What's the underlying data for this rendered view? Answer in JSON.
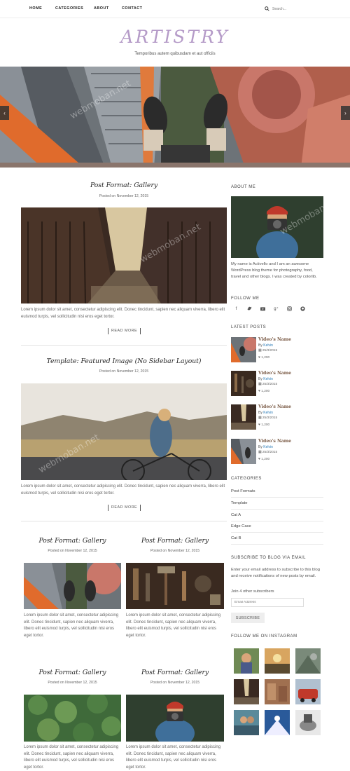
{
  "nav": {
    "items": [
      "HOME",
      "CATEGORIES",
      "ABOUT",
      "CONTACT"
    ],
    "search_placeholder": "Search..."
  },
  "site": {
    "logo": "ARTISTRY",
    "tagline": "Temporibus autem quibusdam et aut officiis"
  },
  "hero": {
    "prev": "‹",
    "next": "›"
  },
  "posts": [
    {
      "title": "Post Format: Gallery",
      "meta": "Posted on November 12, 2015",
      "excerpt": "Lorem ipsum dolor sit amet, consectetur adipiscing elit. Donec tincidunt, sapien nec aliquam viverra, libero elit euismod turpis, vel sollicitudin nisi eros eget tortor.",
      "read_more": "READ MORE"
    },
    {
      "title": "Template: Featured Image (No Sidebar Layout)",
      "meta": "Posted on November 12, 2015",
      "excerpt": "Lorem ipsum dolor sit amet, consectetur adipiscing elit. Donec tincidunt, sapien nec aliquam viverra, libero elit euismod turpis, vel sollicitudin nisi eros eget tortor.",
      "read_more": "READ MORE"
    }
  ],
  "grid_posts": [
    {
      "title": "Post Format: Gallery",
      "meta": "Posted on November 12, 2015",
      "excerpt": "Lorem ipsum dolor sit amet, consectetur adipiscing elit. Donec tincidunt, sapien nec aliquam viverra, libero elit euismod turpis, vel sollicitudin nisi eros eget tortor."
    },
    {
      "title": "Post Format: Gallery",
      "meta": "Posted on November 12, 2015",
      "excerpt": "Lorem ipsum dolor sit amet, consectetur adipiscing elit. Donec tincidunt, sapien nec aliquam viverra, libero elit euismod turpis, vel sollicitudin nisi eros eget tortor."
    },
    {
      "title": "Post Format: Gallery",
      "meta": "Posted on November 12, 2015",
      "excerpt": "Lorem ipsum dolor sit amet, consectetur adipiscing elit. Donec tincidunt, sapien nec aliquam viverra, libero elit euismod turpis, vel sollicitudin nisi eros eget tortor."
    },
    {
      "title": "Post Format: Gallery",
      "meta": "Posted on November 12, 2015",
      "excerpt": "Lorem ipsum dolor sit amet, consectetur adipiscing elit. Donec tincidunt, sapien nec aliquam viverra, libero elit euismod turpis, vel sollicitudin nisi eros eget tortor."
    }
  ],
  "sidebar": {
    "about_heading": "ABOUT ME",
    "about_text": "My name is Activello and I am an awesome WordPress blog theme for photography, food, travel and other blogs. I was created by colorlib.",
    "follow_heading": "FOLLOW ME",
    "social_icons": [
      "facebook-icon",
      "twitter-icon",
      "youtube-icon",
      "google-plus-icon",
      "instagram-icon",
      "github-icon"
    ],
    "latest_heading": "LATEST POSTS",
    "latest_posts": [
      {
        "title": "Video's Name",
        "by": "By",
        "author": "Kelvin",
        "date": "25/3/2015",
        "views": "1,200"
      },
      {
        "title": "Video's Name",
        "by": "By",
        "author": "Kelvin",
        "date": "25/3/2015",
        "views": "1,200"
      },
      {
        "title": "Video's Name",
        "by": "By",
        "author": "Kelvin",
        "date": "25/3/2015",
        "views": "1,200"
      },
      {
        "title": "Video's Name",
        "by": "By",
        "author": "Kelvin",
        "date": "25/3/2015",
        "views": "1,200"
      }
    ],
    "categories_heading": "CATEGORIES",
    "categories": [
      "Post Formats",
      "Template",
      "Cat A",
      "Edge Case",
      "Cat B"
    ],
    "subscribe_heading": "SUBSCRIBE TO BLOG VIA EMAIL",
    "subscribe_text": "Enter your email address to subscribe to this blog and receive notifications of new posts by email.",
    "subscribers": "Join 4 other subscribers",
    "email_placeholder": "Email Address",
    "subscribe_button": "SUBSCRIBE",
    "instagram_heading": "FOLLOW ME ON INSTAGRAM"
  },
  "colors": {
    "accent": "#b59bc8",
    "link": "#2d7cb8",
    "post_link": "#7a5a45"
  }
}
